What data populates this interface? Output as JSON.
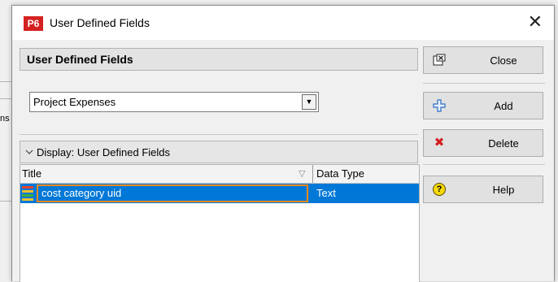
{
  "window": {
    "title": "User Defined Fields",
    "app_badge": "P6",
    "close_glyph": "✕"
  },
  "header": {
    "title": "User Defined Fields"
  },
  "subject_select": {
    "value": "Project Expenses",
    "arrow_glyph": "▼"
  },
  "display_bar": {
    "label": "Display: User Defined Fields",
    "chevron_glyph": "▽"
  },
  "grid": {
    "columns": [
      "Title",
      "Data Type"
    ],
    "sort_glyph": "▽",
    "rows": [
      {
        "title": "cost category uid",
        "data_type": "Text",
        "selected": true
      }
    ]
  },
  "buttons": {
    "close": {
      "label": "Close",
      "icon": "close-window-icon"
    },
    "add": {
      "label": "Add",
      "icon": "plus-outline-icon",
      "glyph": "✚"
    },
    "delete": {
      "label": "Delete",
      "icon": "red-x-icon",
      "glyph": "✖"
    },
    "help": {
      "label": "Help",
      "icon": "help-question-icon",
      "glyph": "?"
    }
  },
  "background": {
    "fragment": "ns"
  },
  "colors": {
    "selection": "#0078d7",
    "edit_border": "#f08a1d",
    "app_badge": "#d5211f"
  }
}
